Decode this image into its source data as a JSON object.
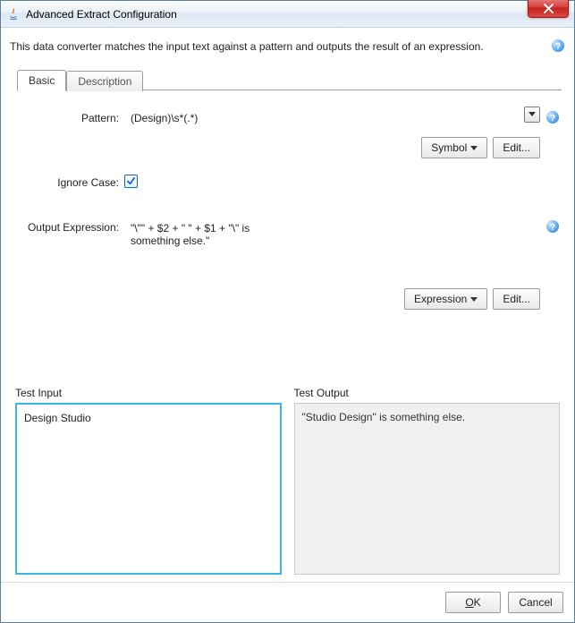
{
  "window": {
    "title": "Advanced Extract Configuration"
  },
  "description": "This data converter matches the input text against a pattern and outputs the result of an expression.",
  "tabs": [
    {
      "label": "Basic",
      "active": true
    },
    {
      "label": "Description",
      "active": false
    }
  ],
  "pattern": {
    "label": "Pattern:",
    "value": "(Design)\\s*(.*)",
    "symbol_btn": "Symbol",
    "edit_btn": "Edit..."
  },
  "ignore_case": {
    "label": "Ignore Case:",
    "checked": true
  },
  "output_expr": {
    "label": "Output Expression:",
    "value": "\"\\\"\" + $2 + \" \" + $1 + \"\\\" is something else.\"",
    "expression_btn": "Expression",
    "edit_btn": "Edit..."
  },
  "test": {
    "input_label": "Test Input",
    "output_label": "Test Output",
    "input_value": "Design Studio",
    "output_value": "\"Studio Design\" is something else."
  },
  "footer": {
    "ok_mnemonic": "O",
    "ok_rest": "K",
    "cancel": "Cancel"
  }
}
